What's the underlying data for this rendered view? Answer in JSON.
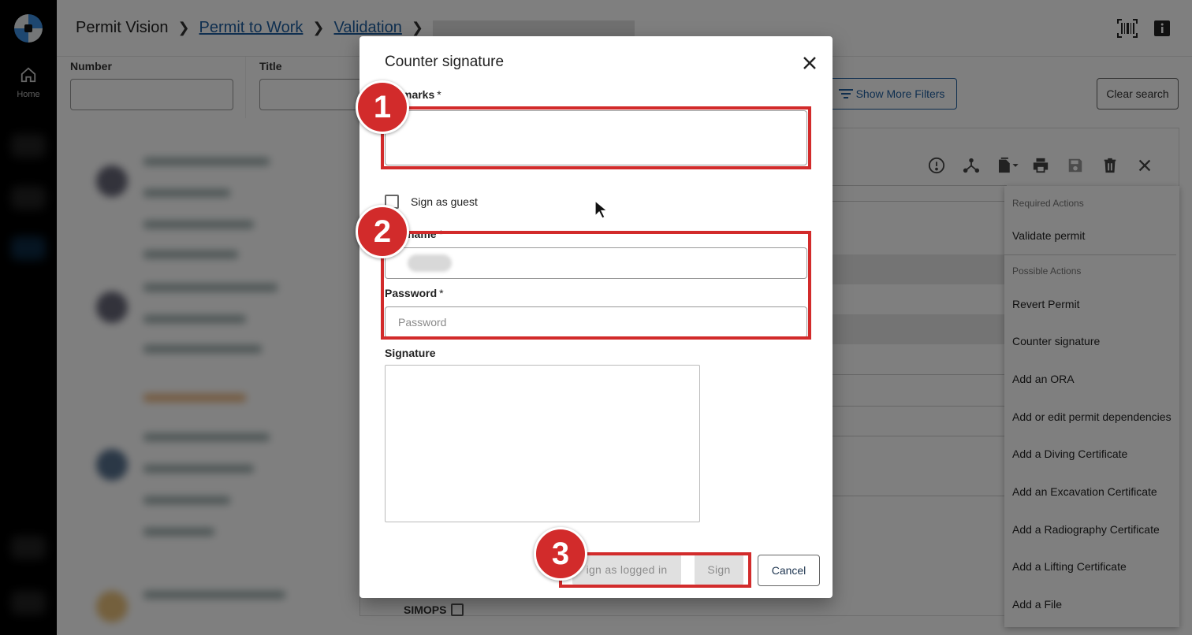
{
  "rail": {
    "home_label": "Home"
  },
  "breadcrumb": {
    "root": "Permit Vision",
    "items": [
      "Permit to Work",
      "Validation"
    ]
  },
  "filters": {
    "number_label": "Number",
    "title_label": "Title",
    "more_filters": "Show More Filters",
    "clear_search": "Clear search"
  },
  "action_menu": {
    "required_heading": "Required Actions",
    "required_items": [
      "Validate permit"
    ],
    "possible_heading": "Possible Actions",
    "possible_items": [
      "Revert Permit",
      "Counter signature",
      "Add an ORA",
      "Add or edit permit dependencies",
      "Add a Diving Certificate",
      "Add an Excavation Certificate",
      "Add a Radiography Certificate",
      "Add a Lifting Certificate",
      "Add a File"
    ]
  },
  "detail": {
    "simops_label": "SIMOPS"
  },
  "dialog": {
    "title": "Counter signature",
    "remarks_label": "marks",
    "required_mark": "*",
    "sign_as_guest": "Sign as guest",
    "username_label": "name",
    "password_label": "Password",
    "password_placeholder": "Password",
    "signature_label": "Signature",
    "sign_logged_in": "ign as logged in",
    "sign": "Sign",
    "cancel": "Cancel"
  },
  "annotations": {
    "badges": [
      "1",
      "2",
      "3"
    ],
    "color": "#d22b2b"
  },
  "colors": {
    "link": "#1f5fa0",
    "overlay": "rgba(0,0,0,0.5)",
    "rail": "#000000"
  }
}
